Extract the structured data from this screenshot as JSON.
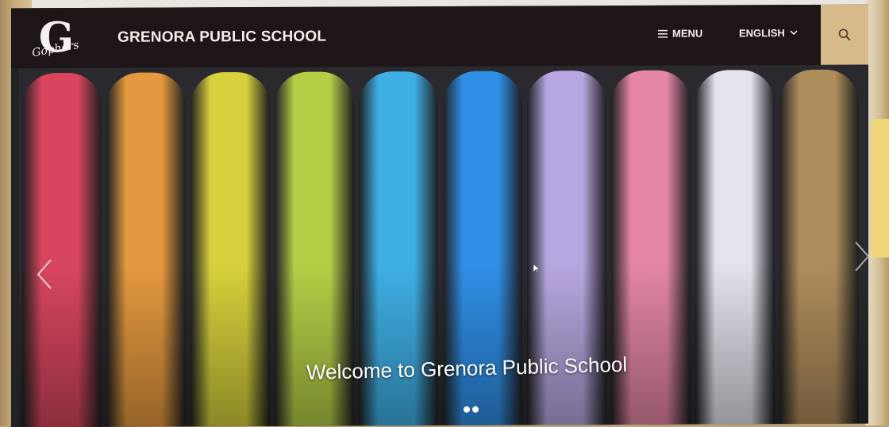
{
  "header": {
    "logo_letter": "G",
    "logo_script": "Gophers",
    "school_name": "GRENORA PUBLIC SCHOOL",
    "menu_label": "MENU",
    "language_label": "ENGLISH"
  },
  "hero": {
    "welcome_text": "Welcome to Grenora Public School",
    "slide_count": 2,
    "chalk_colors": [
      "#d8465e",
      "#e4993e",
      "#d6d13c",
      "#b4cf46",
      "#3fb0e6",
      "#2f8fe6",
      "#b7a7e0",
      "#e486a6",
      "#e3e4ec",
      "#b08d5c"
    ]
  },
  "icons": {
    "menu": "hamburger-icon",
    "language": "chevron-down-icon",
    "search": "search-icon",
    "prev": "chevron-left-icon",
    "next": "chevron-right-icon"
  }
}
